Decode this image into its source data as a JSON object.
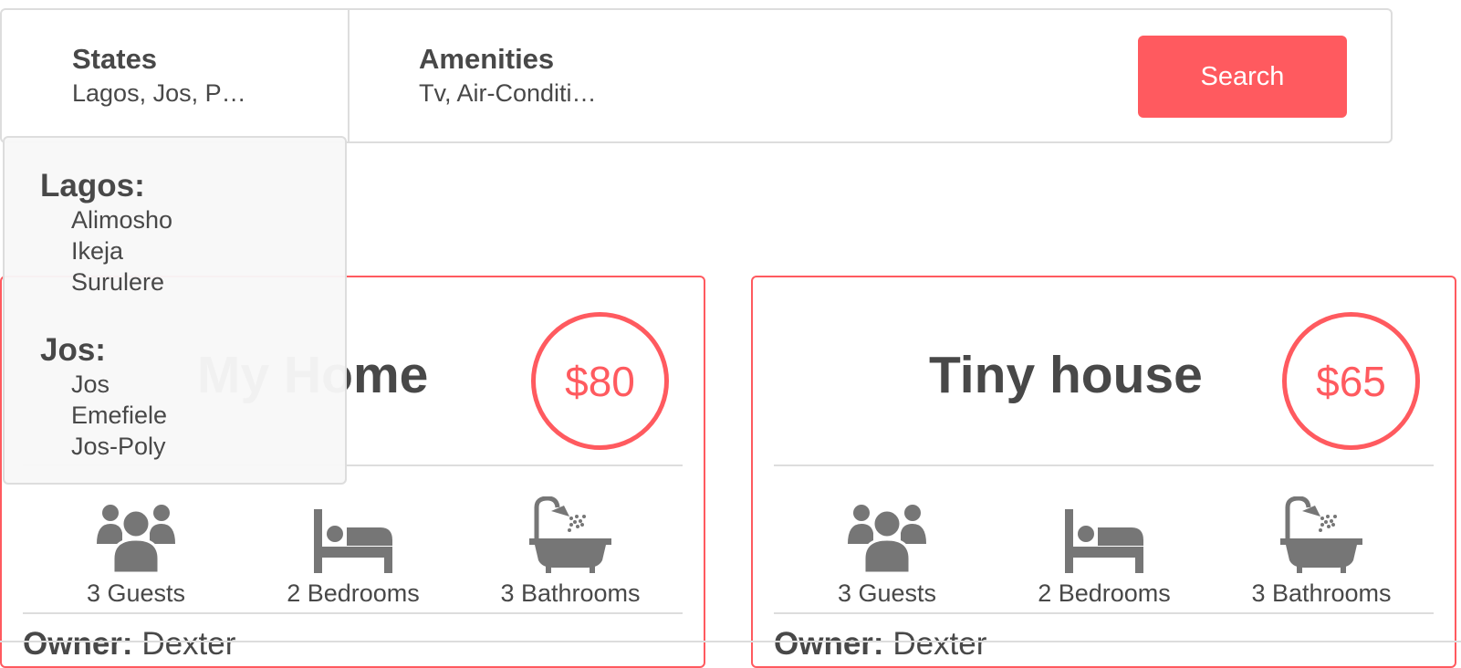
{
  "filters": {
    "states": {
      "title": "States",
      "value": "Lagos, Jos, P…"
    },
    "amenities": {
      "title": "Amenities",
      "value": "Tv, Air-Conditi…"
    },
    "search_label": "Search"
  },
  "dropdown": {
    "states": [
      {
        "name": "Lagos:",
        "cities": [
          "Alimosho",
          "Ikeja",
          "Surulere"
        ]
      },
      {
        "name": "Jos:",
        "cities": [
          "Jos",
          "Emefiele",
          "Jos-Poly"
        ]
      }
    ]
  },
  "places": [
    {
      "title": "My Home",
      "price": "$80",
      "guests": "3 Guests",
      "bedrooms": "2 Bedrooms",
      "bathrooms": "3 Bathrooms",
      "owner_label": "Owner:",
      "owner_name": "Dexter"
    },
    {
      "title": "Tiny house",
      "price": "$65",
      "guests": "3 Guests",
      "bedrooms": "2 Bedrooms",
      "bathrooms": "3 Bathrooms",
      "owner_label": "Owner:",
      "owner_name": "Dexter"
    }
  ],
  "colors": {
    "accent": "#ff5a5f",
    "text": "#484848",
    "border": "#dddddd",
    "icon": "#767676"
  },
  "icons": {
    "guests": "group-icon",
    "bedrooms": "bed-icon",
    "bathrooms": "bathtub-icon"
  }
}
